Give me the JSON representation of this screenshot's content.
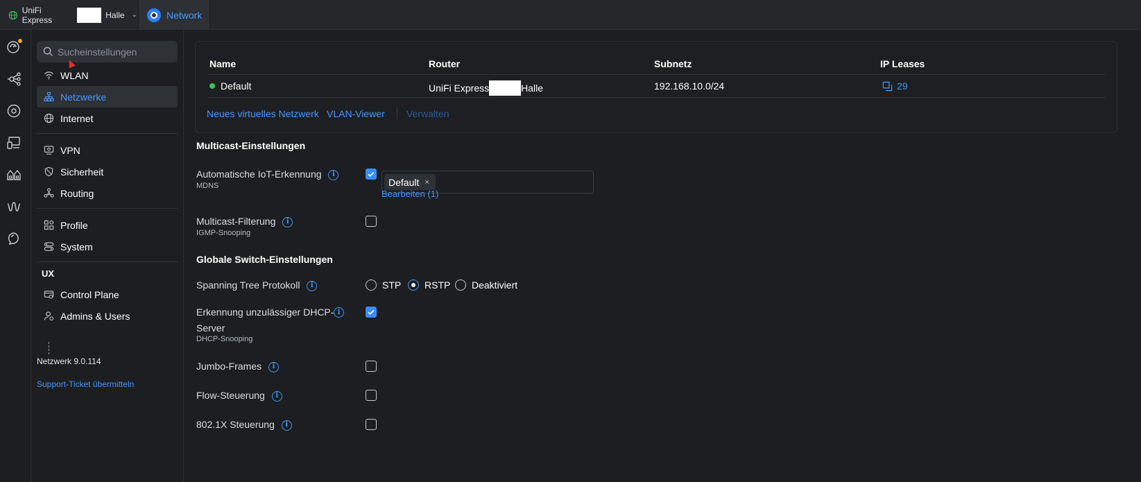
{
  "topbar": {
    "site_name_prefix": "UniFi Express",
    "site_name_suffix": "Halle",
    "app_tab": "Network"
  },
  "sidebar": {
    "search_placeholder": "Sucheinstellungen",
    "items": {
      "wlan": "WLAN",
      "netzwerke": "Netzwerke",
      "internet": "Internet",
      "vpn": "VPN",
      "sicherheit": "Sicherheit",
      "routing": "Routing",
      "profile": "Profile",
      "system": "System",
      "control_plane": "Control Plane",
      "admins_users": "Admins & Users"
    },
    "group_ux": "UX",
    "version": "Netzwerk 9.0.114",
    "support_link": "Support-Ticket übermitteln"
  },
  "networks_table": {
    "headers": {
      "name": "Name",
      "router": "Router",
      "subnet": "Subnetz",
      "ip_leases": "IP Leases"
    },
    "rows": [
      {
        "name": "Default",
        "router_prefix": "UniFi Express",
        "router_suffix": "Halle",
        "subnet": "192.168.10.0/24",
        "ip_leases": "29"
      }
    ],
    "actions": {
      "new_network": "Neues virtuelles Netzwerk",
      "vlan_viewer": "VLAN-Viewer",
      "manage": "Verwalten"
    }
  },
  "multicast": {
    "title": "Multicast-Einstellungen",
    "iot_label": "Automatische IoT-Erkennung",
    "iot_sub": "MDNS",
    "iot_checked": true,
    "iot_tag": "Default",
    "iot_tag_remove": "×",
    "iot_edit": "Bearbeiten (1)",
    "filter_label": "Multicast-Filterung",
    "filter_sub": "IGMP-Snooping",
    "filter_checked": false
  },
  "switch": {
    "title": "Globale Switch-Einstellungen",
    "stp_label": "Spanning Tree Protokoll",
    "stp_options": [
      "STP",
      "RSTP",
      "Deaktiviert"
    ],
    "stp_selected": "RSTP",
    "dhcp_label_line1": "Erkennung unzulässiger DHCP-",
    "dhcp_label_line2": "Server",
    "dhcp_sub": "DHCP-Snooping",
    "dhcp_checked": true,
    "jumbo_label": "Jumbo-Frames",
    "jumbo_checked": false,
    "flow_label": "Flow-Steuerung",
    "flow_checked": false,
    "dot1x_label": "802.1X Steuerung",
    "dot1x_checked": false
  },
  "colors": {
    "accent": "#4797ff",
    "background": "#1c1e21",
    "status_ok": "#3bc25a",
    "notification": "#f5a623"
  },
  "icons": {
    "rail": [
      "dashboard-icon",
      "topology-icon",
      "devices-icon",
      "clients-icon",
      "ports-icon",
      "insights-icon",
      "alarm-icon"
    ]
  },
  "info_glyph": "i"
}
